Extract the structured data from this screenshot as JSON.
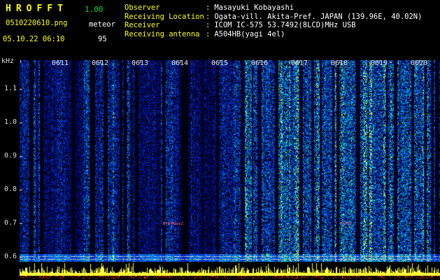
{
  "app": {
    "title": "HROFFT",
    "version": "1.00",
    "filename": "0510220610.png",
    "mode_label": "meteor",
    "datetime": "05.10.22 06:10",
    "meteor_count": "95"
  },
  "station": {
    "separator": ":",
    "rows": [
      {
        "label": "Observer",
        "value": "Masayuki Kobayashi"
      },
      {
        "label": "Receiving Location",
        "value": "Ogata-vill. Akita-Pref. JAPAN (139.96E, 40.02N)"
      },
      {
        "label": "Receiver",
        "value": "ICOM IC-575 53.7492(8LCD)MHz USB"
      },
      {
        "label": "Receiving antenna",
        "value": "A504HB(yagi 4el)"
      }
    ]
  },
  "chart_data": {
    "type": "heatmap",
    "subtype": "radio meteor echo spectrogram (10-minute waterfall)",
    "title": "HROFFT 1.00 spectrogram 05.10.22 06:10",
    "ylabel": "kHz",
    "y_ticks": [
      "1.1",
      "1.0",
      "0.9",
      "0.8",
      "0.7",
      "0.6"
    ],
    "y_range_khz": [
      0.55,
      1.19
    ],
    "x_ticks": [
      "0611",
      "0612",
      "0613",
      "0614",
      "0615",
      "0616",
      "0617",
      "0618",
      "0619",
      "0620"
    ],
    "x_range": [
      "06:10",
      "06:20"
    ],
    "legend": "none",
    "grid": false,
    "content": "dense blue background noise with irregular dark and bright vertical bands; bright noisy horizontal band with two pale lines near 0.6 kHz; faint pink echo dashes near 0.7 kHz; yellow signal-strength bar meter with red overload ticks along the bottom edge"
  },
  "colors": {
    "background": "#000000",
    "header_label_yellow": "#ffff00",
    "version_green": "#00dd44",
    "value_white": "#ffffff",
    "axis_text": "#dcdcdc",
    "noise_blue": "#0030a0",
    "noise_cyan": "#00d2fa",
    "meter_yellow": "#ffff3c",
    "meter_red": "#ff1e14"
  }
}
